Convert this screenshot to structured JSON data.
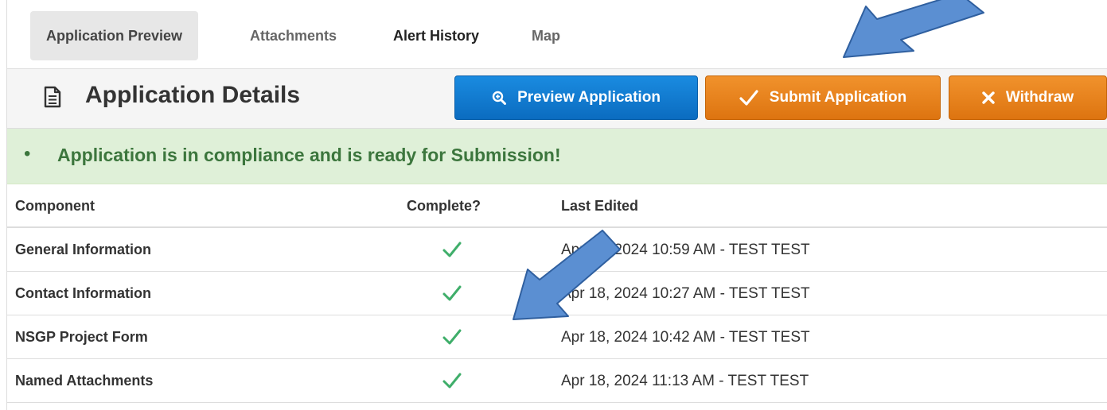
{
  "tabs": [
    {
      "label": "Application Preview",
      "active": true
    },
    {
      "label": "Attachments",
      "active": false
    },
    {
      "label": "Alert History",
      "active": false
    },
    {
      "label": "Map",
      "active": false
    }
  ],
  "header": {
    "title": "Application Details",
    "icon": "document-icon",
    "buttons": {
      "preview": "Preview Application",
      "submit": "Submit Application",
      "withdraw": "Withdraw"
    }
  },
  "alert": {
    "message": "Application is in compliance and is ready for Submission!",
    "color": "#3c763d",
    "background": "#dff0d8"
  },
  "table": {
    "headers": [
      "Component",
      "Complete?",
      "Last Edited"
    ],
    "rows": [
      {
        "component": "General Information",
        "complete": true,
        "last_edited": "Apr 18, 2024 10:59 AM - TEST TEST"
      },
      {
        "component": "Contact Information",
        "complete": true,
        "last_edited": "Apr 18, 2024 10:27 AM - TEST TEST"
      },
      {
        "component": "NSGP Project Form",
        "complete": true,
        "last_edited": "Apr 18, 2024 10:42 AM - TEST TEST"
      },
      {
        "component": "Named Attachments",
        "complete": true,
        "last_edited": "Apr 18, 2024 11:13 AM - TEST TEST"
      }
    ]
  },
  "colors": {
    "primary": "#0b6cc0",
    "warning": "#e8821c",
    "success_check": "#3fae6a",
    "annotation_arrow": "#5b8fd2"
  }
}
